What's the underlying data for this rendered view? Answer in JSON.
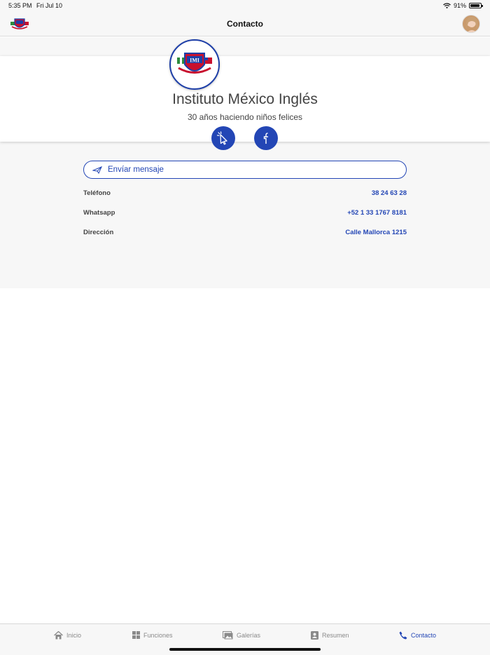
{
  "status_bar": {
    "time": "5:35 PM",
    "date": "Fri Jul 10",
    "battery": "91%",
    "battery_level": 0.91
  },
  "nav": {
    "title": "Contacto"
  },
  "profile": {
    "name": "Instituto México Inglés",
    "tagline": "30 años haciendo niños felices",
    "logo_text": "IMI"
  },
  "actions": {
    "send_message": "Envíar mensaje"
  },
  "contact": [
    {
      "label": "Teléfono",
      "value": "38 24 63 28"
    },
    {
      "label": "Whatsapp",
      "value": "+52 1 33 1767 8181"
    },
    {
      "label": "Dirección",
      "value": "Calle Mallorca 1215"
    }
  ],
  "tabs": [
    {
      "label": "Inicio",
      "icon": "home-icon"
    },
    {
      "label": "Funciones",
      "icon": "grid-icon"
    },
    {
      "label": "Galerías",
      "icon": "gallery-icon"
    },
    {
      "label": "Resumen",
      "icon": "profile-card-icon"
    },
    {
      "label": "Contacto",
      "icon": "phone-icon",
      "active": true
    }
  ],
  "colors": {
    "accent": "#2346b5",
    "background": "#f7f7f7",
    "card": "#ffffff"
  }
}
